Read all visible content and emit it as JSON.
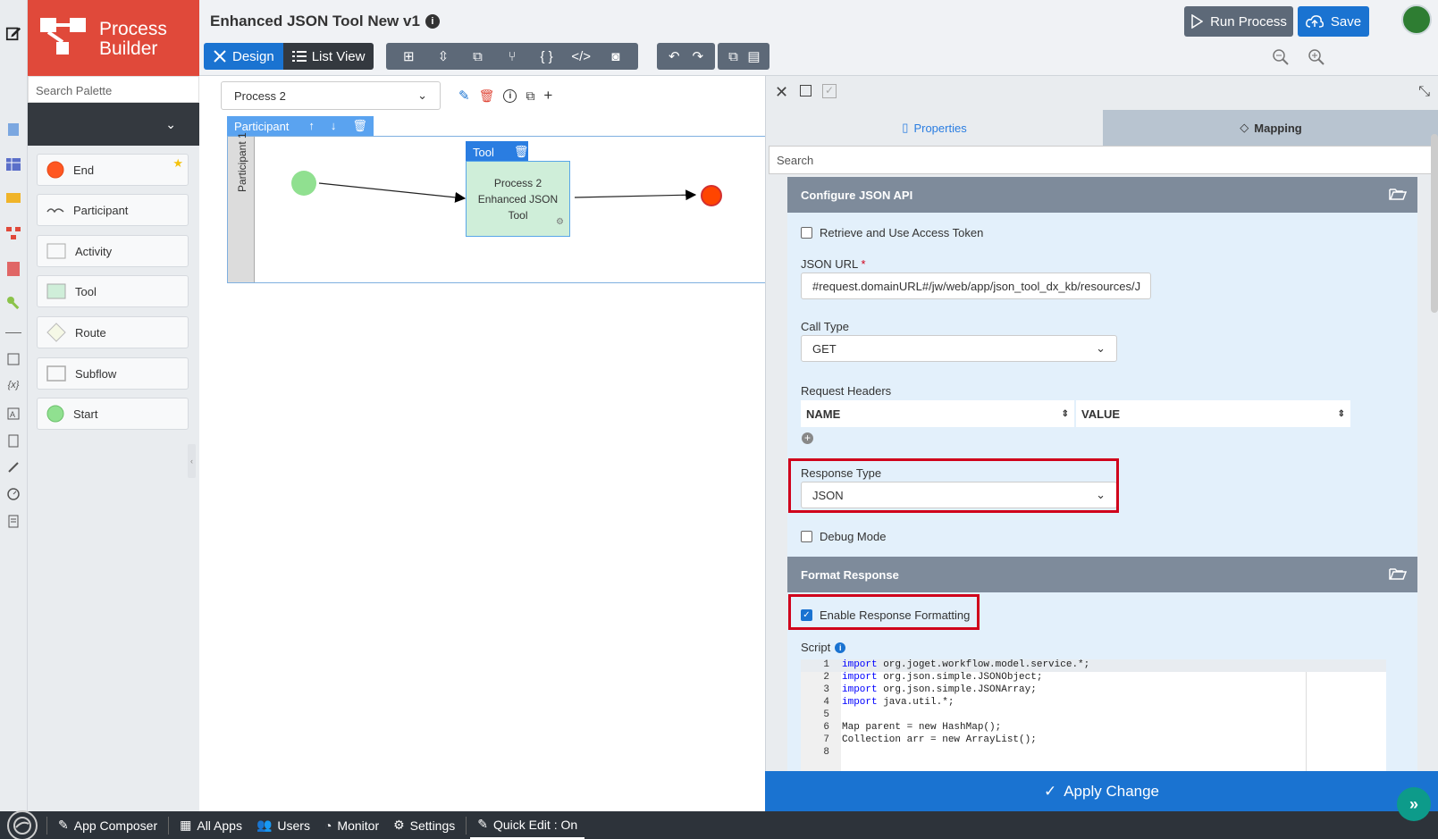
{
  "brand": {
    "line1": "Process",
    "line2": "Builder"
  },
  "header": {
    "title": "Enhanced JSON Tool New v1",
    "design_label": "Design",
    "listview_label": "List View",
    "run_label": "Run Process",
    "save_label": "Save"
  },
  "palette": {
    "search_placeholder": "Search Palette",
    "items": [
      {
        "label": "End"
      },
      {
        "label": "Participant"
      },
      {
        "label": "Activity"
      },
      {
        "label": "Tool"
      },
      {
        "label": "Route"
      },
      {
        "label": "Subflow"
      },
      {
        "label": "Start"
      }
    ]
  },
  "canvas": {
    "process_select": "Process 2",
    "participant_tab": "Participant",
    "lane_label": "Participant 1",
    "tool_tab": "Tool",
    "tool_box_lines": [
      "Process 2",
      "Enhanced JSON",
      "Tool"
    ]
  },
  "panel": {
    "tabs": {
      "properties": "Properties",
      "mapping": "Mapping"
    },
    "search_placeholder": "Search",
    "section1": "Configure JSON API",
    "retrieve_token": "Retrieve and Use Access Token",
    "json_url_label": "JSON URL",
    "json_url_required": "*",
    "json_url_value": "#request.domainURL#/jw/web/app/json_tool_dx_kb/resources/J",
    "call_type_label": "Call Type",
    "call_type_value": "GET",
    "request_headers_label": "Request Headers",
    "col_name": "NAME",
    "col_value": "VALUE",
    "response_type_label": "Response Type",
    "response_type_value": "JSON",
    "debug_mode": "Debug Mode",
    "section2": "Format Response",
    "enable_formatting": "Enable Response Formatting",
    "script_label": "Script",
    "code_lines": [
      {
        "n": "1",
        "kw": "import",
        "rest": " org.joget.workflow.model.service.*;"
      },
      {
        "n": "2",
        "kw": "import",
        "rest": " org.json.simple.JSONObject;"
      },
      {
        "n": "3",
        "kw": "import",
        "rest": " org.json.simple.JSONArray;"
      },
      {
        "n": "4",
        "kw": "import",
        "rest": " java.util.*;"
      },
      {
        "n": "5",
        "kw": "",
        "rest": ""
      },
      {
        "n": "6",
        "kw": "",
        "rest": "Map parent = new HashMap();"
      },
      {
        "n": "7",
        "kw": "",
        "rest": "Collection arr = new ArrayList();"
      },
      {
        "n": "8",
        "kw": "",
        "rest": ""
      }
    ],
    "apply_label": "Apply Change"
  },
  "bottombar": {
    "app_composer": "App Composer",
    "all_apps": "All Apps",
    "users": "Users",
    "monitor": "Monitor",
    "settings": "Settings",
    "quick_edit": "Quick Edit : On"
  },
  "colors": {
    "brand_red": "#e0493a",
    "primary_blue": "#1a73d1",
    "highlight_red": "#d0021b",
    "start_green": "#90e090",
    "end_orange": "#ff4500"
  }
}
